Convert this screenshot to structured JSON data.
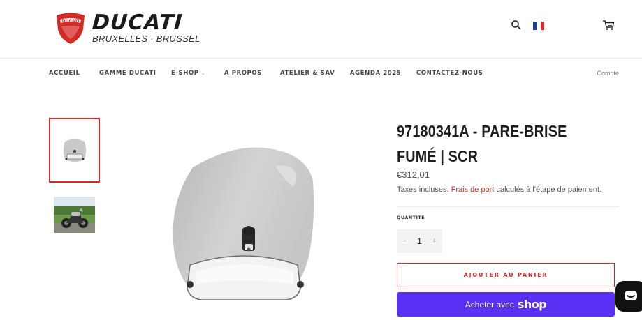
{
  "header": {
    "brand_name": "DUCATI",
    "brand_sub": "BRUXELLES · BRUSSEL",
    "shield_text": "DUCATI",
    "icons": [
      "search-icon",
      "flag-fr-icon",
      "cart-icon"
    ]
  },
  "nav": {
    "items": [
      {
        "label": "ACCUEIL"
      },
      {
        "label": "GAMME DUCATI"
      },
      {
        "label": "E-SHOP"
      },
      {
        "label": "A PROPOS"
      },
      {
        "label": "ATELIER & SAV"
      },
      {
        "label": "AGENDA 2025"
      },
      {
        "label": "CONTACTEZ-NOUS"
      }
    ],
    "account": "Compte"
  },
  "product": {
    "title": "97180341A - PARE-BRISE FUMÉ | SCR",
    "price": "€312,01",
    "tax_prefix": "Taxes incluses. ",
    "tax_link": "Frais de port",
    "tax_suffix": " calculés à l'étape de paiement.",
    "quantity_label": "QUANTITÉ",
    "quantity_value": "1",
    "qty_minus": "−",
    "qty_plus": "+",
    "add_to_cart": "AJOUTER AU PANIER",
    "shop_pay_prefix": "Acheter avec",
    "shop_pay_logo": "shop"
  },
  "colors": {
    "accent": "#d42a26",
    "shop_pay": "#5a31f4",
    "link": "#c4302b"
  }
}
